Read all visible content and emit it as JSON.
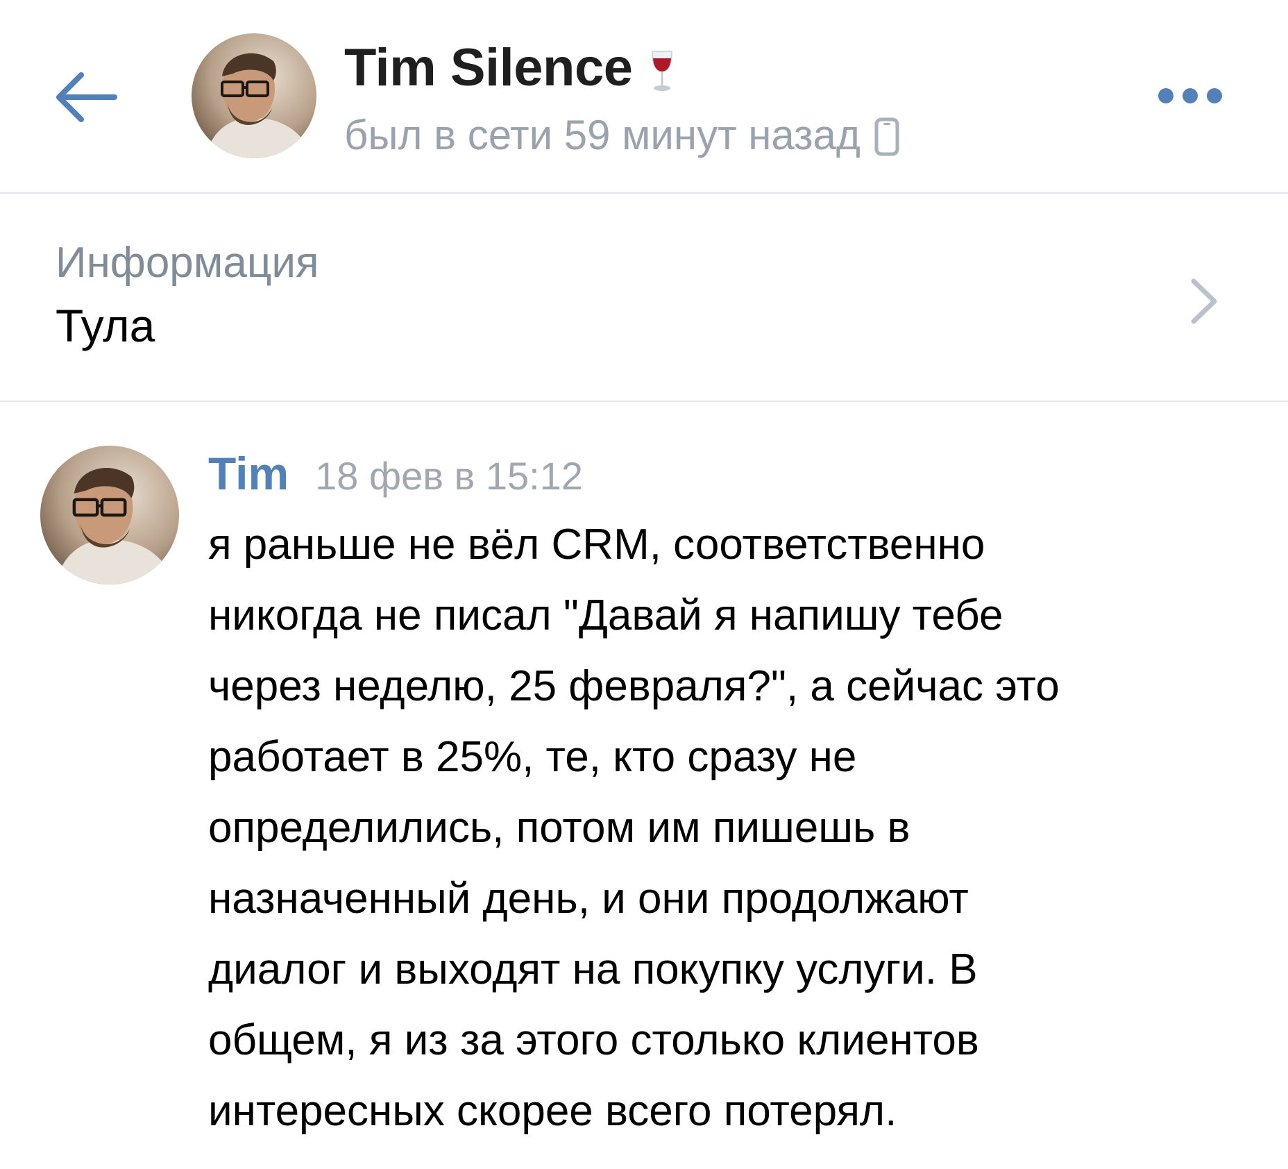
{
  "header": {
    "name": "Tim Silence",
    "status": "был в сети 59 минут назад",
    "status_emoji_icon": "wine-glass-icon",
    "device_icon": "mobile-phone-icon",
    "back_icon": "arrow-left-icon",
    "more_icon": "more-horizontal-icon"
  },
  "info": {
    "label": "Информация",
    "value": "Тула",
    "chevron_icon": "chevron-right-icon"
  },
  "message": {
    "author": "Tim",
    "time": "18 фев в 15:12",
    "lines": [
      "я раньше не вёл CRM, соответственно",
      "никогда не писал \"Давай я напишу тебе",
      "через неделю, 25 февраля?\", а сейчас это",
      "работает в 25%, те, кто сразу не",
      "определились, потом им пишешь в",
      "назначенный день, и они продолжают",
      "диалог и выходят на покупку услуги. В",
      "общем, я из за этого столько клиентов",
      "интересных скорее всего потерял."
    ]
  },
  "colors": {
    "accent": "#5181b8",
    "secondary_text": "#99a2ad",
    "divider": "#e3e4e8",
    "text": "#000000"
  }
}
